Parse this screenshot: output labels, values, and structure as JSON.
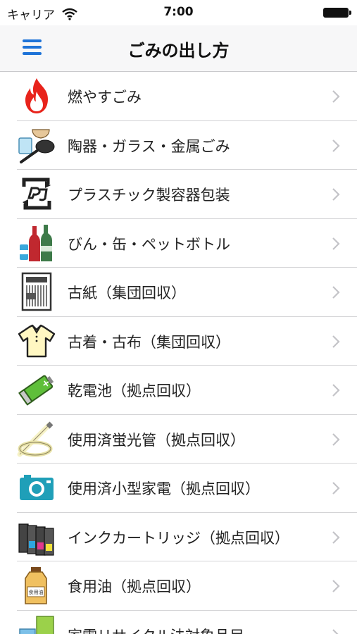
{
  "status_bar": {
    "carrier": "キャリア",
    "time": "7:00"
  },
  "nav": {
    "title": "ごみの出し方",
    "menu_icon": "hamburger-menu-icon",
    "accent_color": "#1e73d8"
  },
  "items": [
    {
      "label": "燃やすごみ",
      "icon": "fire-icon"
    },
    {
      "label": "陶器・ガラス・金属ごみ",
      "icon": "ceramics-pan-icon"
    },
    {
      "label": "プラスチック製容器包装",
      "icon": "plastic-recycle-icon"
    },
    {
      "label": "びん・缶・ペットボトル",
      "icon": "bottles-cans-icon"
    },
    {
      "label": "古紙（集団回収）",
      "icon": "newspaper-icon"
    },
    {
      "label": "古着・古布（集団回収）",
      "icon": "shirt-icon"
    },
    {
      "label": "乾電池（拠点回収）",
      "icon": "battery-icon"
    },
    {
      "label": "使用済蛍光管（拠点回収）",
      "icon": "fluorescent-tube-icon"
    },
    {
      "label": "使用済小型家電（拠点回収）",
      "icon": "camera-icon"
    },
    {
      "label": "インクカートリッジ（拠点回収）",
      "icon": "ink-cartridge-icon"
    },
    {
      "label": "食用油（拠点回収）",
      "icon": "cooking-oil-icon"
    },
    {
      "label": "家電リサイクル法対象品目",
      "icon": "appliance-icon"
    }
  ],
  "oil_label": "食用油"
}
